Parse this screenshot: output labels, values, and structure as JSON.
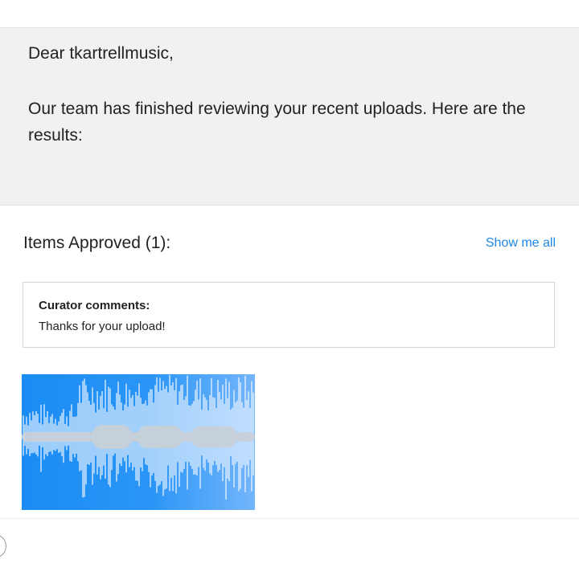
{
  "email": {
    "greeting": "Dear tkartrellmusic,",
    "message": "Our team has finished reviewing your recent uploads. Here are the results:"
  },
  "approved": {
    "heading": "Items Approved (1):",
    "show_all_label": "Show me all",
    "curator_title": "Curator comments:",
    "curator_comment": "Thanks for your upload!",
    "thumbnail_icon": "waveform-thumbnail"
  },
  "colors": {
    "link": "#1f87e5",
    "intro_background": "#f1f1f1",
    "thumbnail_blue": "#1a8cf3",
    "waveform_center": "#c6d0da"
  }
}
